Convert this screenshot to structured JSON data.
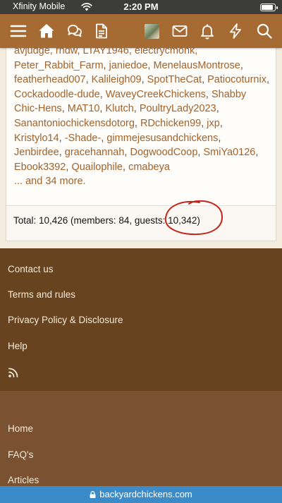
{
  "status_bar": {
    "carrier": "Xfinity Mobile",
    "time": "2:20 PM",
    "battery_level": 0.9
  },
  "navbar": {
    "icons": [
      "menu-icon",
      "home-icon",
      "chat-bubbles-icon",
      "document-icon",
      "avatar",
      "envelope-icon",
      "bell-icon",
      "lightning-icon",
      "search-icon"
    ],
    "colors": {
      "bar": "#a66a33",
      "icon": "#ffffff"
    }
  },
  "online_members": {
    "partial_first_line": "avjudge, rhdw, LTAY1946, electrycmonk,",
    "names": [
      "Peter_Rabbit_Farm",
      "janiedoe",
      "MenelausMontrose",
      "featherhead007",
      "Kalileigh09",
      "SpotTheCat",
      "Patiocoturnix",
      "Cockadoodle-dude",
      "WaveyCreekChickens",
      "Shabby Chic-Hens",
      "MAT10",
      "Klutch",
      "PoultryLady2023",
      "Sanantoniochickensdotorg",
      "RDchicken99",
      "jxp",
      "Kristylo14",
      "-Shade-",
      "gimmejesusandchickens",
      "Jenbirdee",
      "gracehannah",
      "DogwoodCoop",
      "SmiYa0126",
      "Ebook3392",
      "Quailophile",
      "cmabeya"
    ],
    "more_text": "... and 34 more."
  },
  "totals": {
    "text_prefix": "Total: 10,426 (members: 84, guests: ",
    "guests": "10,342",
    "text_suffix": ")"
  },
  "footer_links": {
    "contact": "Contact us",
    "terms": "Terms and rules",
    "privacy": "Privacy Policy & Disclosure",
    "help": "Help",
    "rss_icon": "rss-icon"
  },
  "footer_nav": {
    "home": "Home",
    "faqs": "FAQ's",
    "articles": "Articles"
  },
  "url_bar": {
    "domain": "backyardchickens.com"
  },
  "colors": {
    "link": "#a1622c",
    "footer_dark": "#68431f",
    "footer_light": "#7a5231",
    "url_bar": "#3a8bc8",
    "annotation": "#c0261d"
  }
}
